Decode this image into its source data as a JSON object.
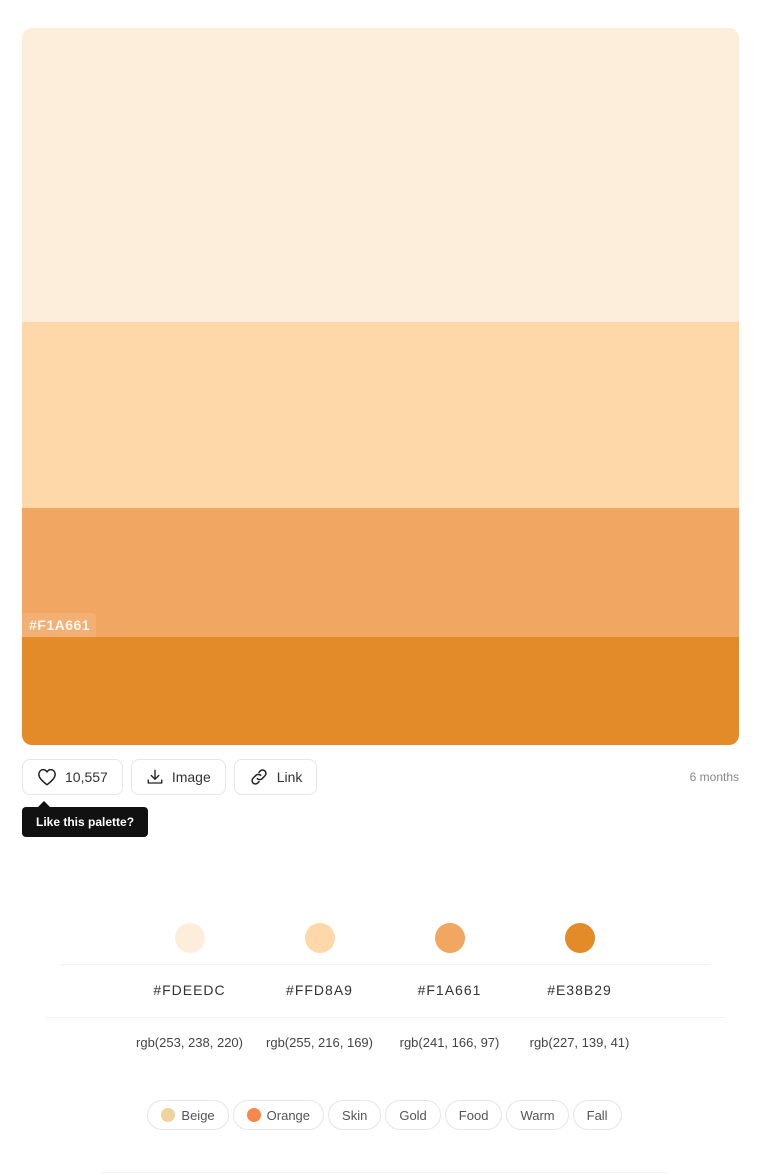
{
  "palette": {
    "swatches": [
      {
        "hex": "#FDEEDC",
        "color": "#FDEEDC"
      },
      {
        "hex": "#FFD8A9",
        "color": "#FFD8A9"
      },
      {
        "hex": "#F1A661",
        "color": "#F1A661"
      },
      {
        "hex": "#E38B29",
        "color": "#E38B29"
      }
    ],
    "hover_label": "#F1A661"
  },
  "actions": {
    "likes": "10,557",
    "image_label": "Image",
    "link_label": "Link",
    "time": "6 months",
    "tooltip": "Like this palette?"
  },
  "colors": [
    {
      "hex": "#FDEEDC",
      "rgb": "rgb(253, 238, 220)",
      "color": "#FDEEDC"
    },
    {
      "hex": "#FFD8A9",
      "rgb": "rgb(255, 216, 169)",
      "color": "#FFD8A9"
    },
    {
      "hex": "#F1A661",
      "rgb": "rgb(241, 166, 97)",
      "color": "#F1A661"
    },
    {
      "hex": "#E38B29",
      "rgb": "rgb(227, 139, 41)",
      "color": "#E38B29"
    }
  ],
  "tags": [
    {
      "label": "Beige",
      "dot": "#EFD29E"
    },
    {
      "label": "Orange",
      "dot": "#F5884A"
    },
    {
      "label": "Skin"
    },
    {
      "label": "Gold"
    },
    {
      "label": "Food"
    },
    {
      "label": "Warm"
    },
    {
      "label": "Fall"
    }
  ]
}
